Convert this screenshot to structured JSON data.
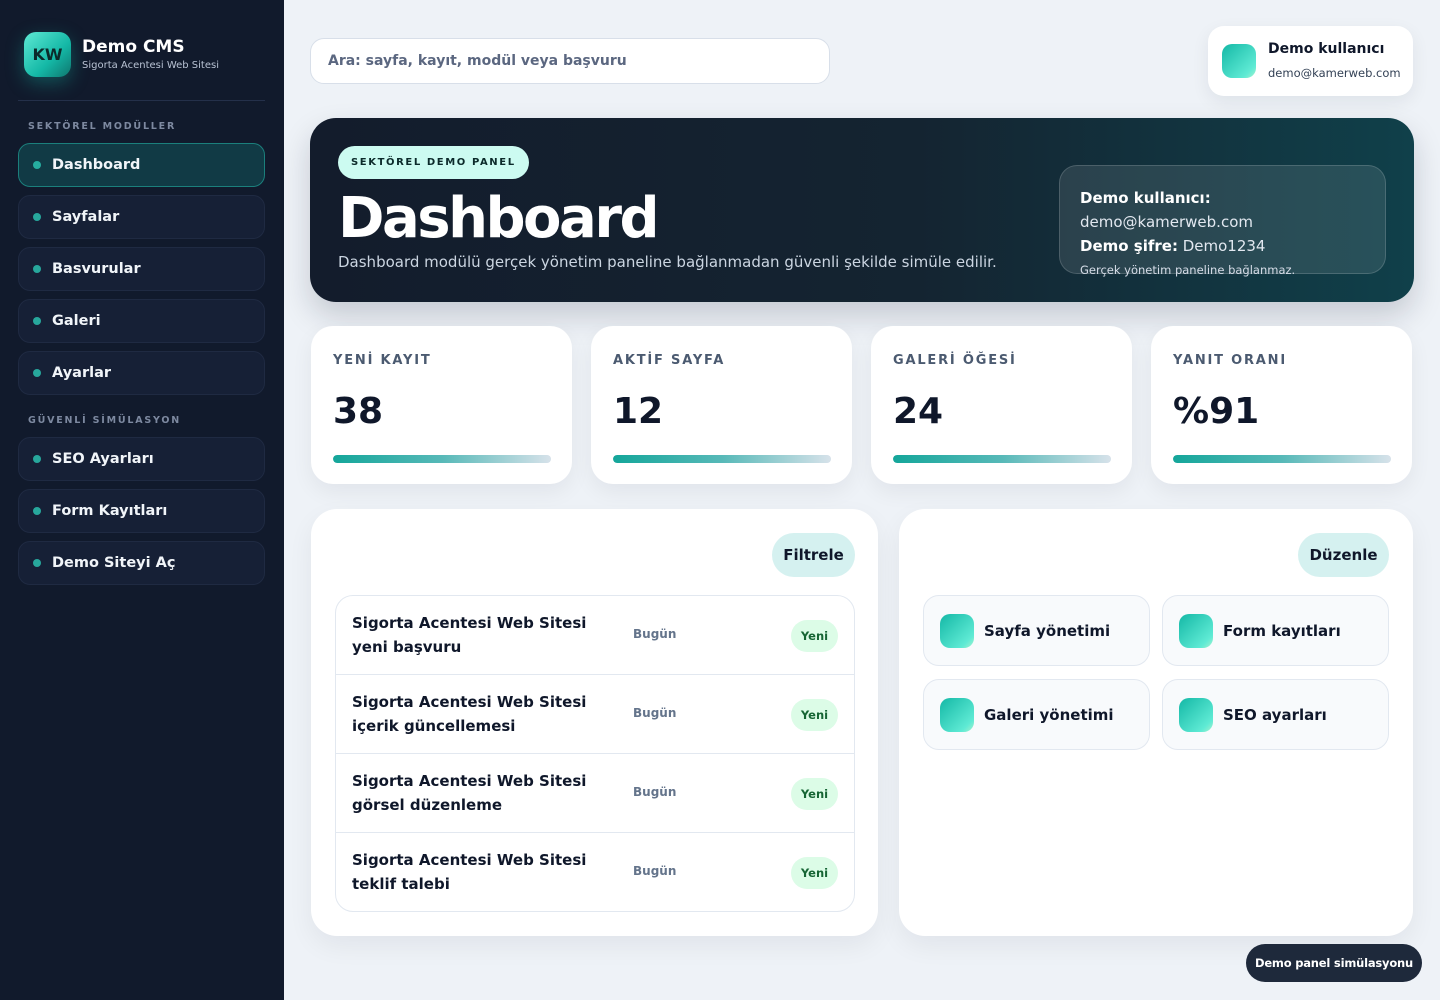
{
  "brand": {
    "logo": "KW",
    "title": "Demo CMS",
    "subtitle": "Sigorta Acentesi Web Sitesi"
  },
  "sidebar": {
    "section1": "SEKTÖREL MODÜLLER",
    "section2": "GÜVENLİ SİMÜLASYON",
    "items": [
      {
        "label": "Dashboard",
        "active": true
      },
      {
        "label": "Sayfalar"
      },
      {
        "label": "Basvurular"
      },
      {
        "label": "Galeri"
      },
      {
        "label": "Ayarlar"
      },
      {
        "label": "SEO Ayarları"
      },
      {
        "label": "Form Kayıtları"
      },
      {
        "label": "Demo Siteyi Aç"
      }
    ]
  },
  "search": {
    "placeholder": "Ara: sayfa, kayıt, modül veya başvuru"
  },
  "user": {
    "name": "Demo kullanıcı",
    "email": "demo@kamerweb.com"
  },
  "hero": {
    "badge": "SEKTÖREL DEMO PANEL",
    "title": "Dashboard",
    "description": "Dashboard modülü gerçek yönetim paneline bağlanmadan güvenli şekilde simüle edilir.",
    "info": {
      "user_label": "Demo kullanıcı:",
      "user_value": "demo@kamerweb.com",
      "pass_label": "Demo şifre:",
      "pass_value": "Demo1234",
      "note": "Gerçek yönetim paneline bağlanmaz."
    }
  },
  "stats": [
    {
      "label": "YENİ KAYIT",
      "value": "38",
      "progress": 1.0
    },
    {
      "label": "AKTİF SAYFA",
      "value": "12",
      "progress": 1.0
    },
    {
      "label": "GALERİ ÖĞESİ",
      "value": "24",
      "progress": 1.0
    },
    {
      "label": "YANIT ORANI",
      "value": "%91",
      "progress": 1.0
    }
  ],
  "activity": {
    "filter_label": "Filtrele",
    "rows": [
      {
        "title": "Sigorta Acentesi Web Sitesi yeni başvuru",
        "date": "Bugün",
        "status": "Yeni"
      },
      {
        "title": "Sigorta Acentesi Web Sitesi içerik güncellemesi",
        "date": "Bugün",
        "status": "Yeni"
      },
      {
        "title": "Sigorta Acentesi Web Sitesi görsel düzenleme",
        "date": "Bugün",
        "status": "Yeni"
      },
      {
        "title": "Sigorta Acentesi Web Sitesi teklif talebi",
        "date": "Bugün",
        "status": "Yeni"
      }
    ]
  },
  "quick": {
    "edit_label": "Düzenle",
    "tiles": [
      {
        "label": "Sayfa yönetimi"
      },
      {
        "label": "Form kayıtları"
      },
      {
        "label": "Galeri yönetimi"
      },
      {
        "label": "SEO ayarları"
      }
    ]
  },
  "footer": {
    "label": "Demo panel simülasyonu"
  },
  "colors": {
    "sidebar_bg": "#111a2c",
    "accent": "#14b8a6",
    "hero_bg": "#131c2c",
    "badge_green": "#dcfce7"
  }
}
